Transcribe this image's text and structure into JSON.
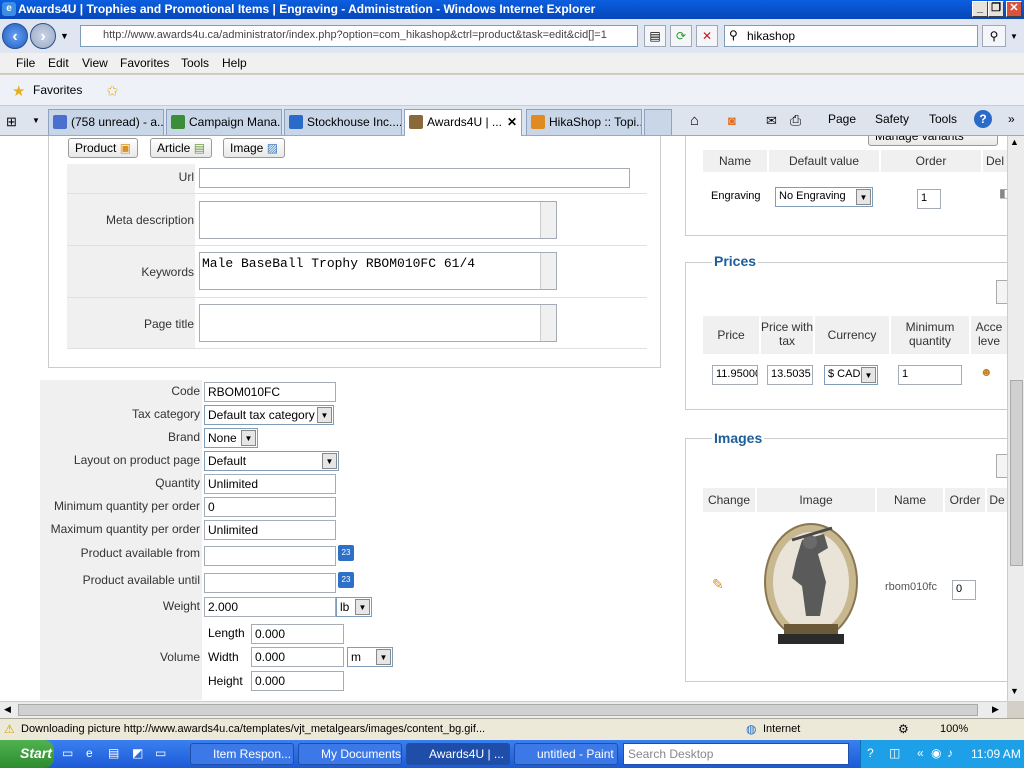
{
  "window": {
    "title": "Awards4U | Trophies and Promotional Items | Engraving - Administration - Windows Internet Explorer",
    "minimize": "_",
    "restore": "❐",
    "close": "✕"
  },
  "address": {
    "url": "http://www.awards4u.ca/administrator/index.php?option=com_hikashop&ctrl=product&task=edit&cid[]=1",
    "search_value": "hikashop"
  },
  "menu": [
    "File",
    "Edit",
    "View",
    "Favorites",
    "Tools",
    "Help"
  ],
  "favorites": {
    "label": "Favorites"
  },
  "tabs": [
    {
      "label": "(758 unread) - a...",
      "color": "#4a6fd0"
    },
    {
      "label": "Campaign Mana...",
      "color": "#3a8e3a"
    },
    {
      "label": "Stockhouse Inc....",
      "color": "#2a6ac8"
    },
    {
      "label": "Awards4U | ...",
      "color": "#8a6a3a"
    },
    {
      "label": "HikaShop :: Topi...",
      "color": "#e08a20"
    }
  ],
  "commandbar": {
    "page": "Page",
    "safety": "Safety",
    "tools": "Tools"
  },
  "insert_buttons": {
    "product": "Product",
    "article": "Article",
    "image": "Image"
  },
  "meta": {
    "url_label": "Url",
    "url_value": "",
    "meta_desc_label": "Meta description",
    "keywords_label": "Keywords",
    "keywords_value": "Male BaseBall Trophy  RBOM010FC 61/4",
    "page_title_label": "Page title"
  },
  "fields": {
    "code_label": "Code",
    "code_value": "RBOM010FC",
    "tax_label": "Tax category",
    "tax_value": "Default tax category",
    "brand_label": "Brand",
    "brand_value": "None",
    "layout_label": "Layout on product page",
    "layout_value": "Default",
    "quantity_label": "Quantity",
    "quantity_value": "Unlimited",
    "min_qty_label": "Minimum quantity per order",
    "min_qty_value": "0",
    "max_qty_label": "Maximum quantity per order",
    "max_qty_value": "Unlimited",
    "avail_from_label": "Product available from",
    "avail_until_label": "Product available until",
    "weight_label": "Weight",
    "weight_value": "2.000",
    "weight_unit": "lb",
    "volume_label": "Volume",
    "length_label": "Length",
    "length_value": "0.000",
    "width_label": "Width",
    "width_value": "0.000",
    "width_unit": "m",
    "height_label": "Height",
    "height_value": "0.000",
    "calendar_glyph": "23"
  },
  "characteristics": {
    "manage_variants": "Manage variants",
    "headers": {
      "name": "Name",
      "default_value": "Default value",
      "order": "Order",
      "delete": "Del"
    },
    "row": {
      "name": "Engraving",
      "default_value": "No Engraving",
      "order": "1"
    }
  },
  "prices": {
    "title": "Prices",
    "headers": {
      "price": "Price",
      "price_tax": "Price with tax",
      "currency": "Currency",
      "min_qty": "Minimum quantity",
      "access": "Acce leve"
    },
    "row": {
      "price": "11.95000",
      "price_tax": "13.5035",
      "currency": "$ CAD",
      "min_qty": "1"
    }
  },
  "images": {
    "title": "Images",
    "headers": {
      "change": "Change",
      "image": "Image",
      "name": "Name",
      "order": "Order",
      "delete": "De"
    },
    "row": {
      "name": "rbom010fc",
      "order": "0"
    }
  },
  "status": {
    "text": "Downloading picture http://www.awards4u.ca/templates/vjt_metalgears/images/content_bg.gif...",
    "zone": "Internet",
    "zoom": "100%"
  },
  "taskbar": {
    "start": "Start",
    "items": [
      {
        "label": "Item Respon..."
      },
      {
        "label": "My Documents"
      },
      {
        "label": "Awards4U | ..."
      },
      {
        "label": "untitled - Paint"
      }
    ],
    "search_placeholder": "Search Desktop",
    "clock": "11:09 AM"
  }
}
